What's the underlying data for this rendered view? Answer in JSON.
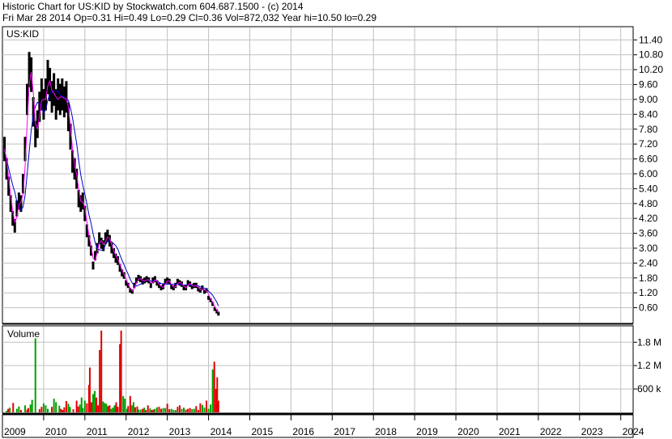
{
  "header": {
    "line1": "Historic Chart for US:KID by Stockwatch.com 604.687.1500 - (c) 2014",
    "line2": "Fri Mar 28 2014   Op=0.31   Hi=0.49   Lo=0.29   Cl=0.36   Vol=872,032   Year hi=10.50   lo=0.29"
  },
  "colors": {
    "grid": "#c0c0c0",
    "price": "#000000",
    "ma_short": "#ff00ff",
    "ma_long": "#0000cc",
    "vol_up": "#00a000",
    "vol_down": "#e00000"
  },
  "chart_data": [
    {
      "type": "line",
      "title": "US:KID",
      "y_ticks": [
        "11.40",
        "10.80",
        "10.20",
        "9.60",
        "9.00",
        "8.40",
        "7.80",
        "7.20",
        "6.60",
        "6.00",
        "5.40",
        "4.80",
        "4.20",
        "3.60",
        "3.00",
        "2.40",
        "1.80",
        "1.20",
        "0.60"
      ],
      "ylim": [
        0,
        11.9
      ],
      "x_labels": [
        "2009",
        "2010",
        "2011",
        "2012",
        "2013",
        "2014",
        "2015",
        "2016",
        "2017",
        "2018",
        "2019",
        "2020",
        "2021",
        "2022",
        "2023",
        "2024"
      ],
      "x_range": [
        2009.0,
        2024.3
      ],
      "series": [
        {
          "x": [
            2009.05,
            2009.1,
            2009.15,
            2009.2,
            2009.25,
            2009.3,
            2009.35,
            2009.4,
            2009.45,
            2009.5,
            2009.55,
            2009.6,
            2009.65,
            2009.7,
            2009.75,
            2009.8,
            2009.85,
            2009.9,
            2009.95,
            2010.0,
            2010.05,
            2010.1,
            2010.15,
            2010.2,
            2010.25,
            2010.3,
            2010.35,
            2010.4,
            2010.45,
            2010.5,
            2010.55,
            2010.6,
            2010.65,
            2010.7,
            2010.75,
            2010.8,
            2010.85,
            2010.9,
            2010.95,
            2011.0,
            2011.05,
            2011.1,
            2011.15,
            2011.2,
            2011.25,
            2011.3,
            2011.35,
            2011.4,
            2011.45,
            2011.5,
            2011.55,
            2011.6,
            2011.65,
            2011.7,
            2011.75,
            2011.8,
            2011.85,
            2011.9,
            2011.95,
            2012.0,
            2012.05,
            2012.1,
            2012.15,
            2012.2,
            2012.25,
            2012.3,
            2012.35,
            2012.4,
            2012.45,
            2012.5,
            2012.55,
            2012.6,
            2012.65,
            2012.7,
            2012.75,
            2012.8,
            2012.85,
            2012.9,
            2012.95,
            2013.0,
            2013.05,
            2013.1,
            2013.15,
            2013.2,
            2013.25,
            2013.3,
            2013.35,
            2013.4,
            2013.45,
            2013.5,
            2013.55,
            2013.6,
            2013.65,
            2013.7,
            2013.75,
            2013.8,
            2013.85,
            2013.9,
            2013.95,
            2014.0,
            2014.05,
            2014.1,
            2014.15,
            2014.2,
            2014.24
          ],
          "values": [
            7.0,
            6.2,
            5.5,
            4.8,
            4.2,
            3.9,
            4.6,
            4.9,
            4.8,
            5.6,
            7.0,
            9.0,
            10.2,
            10.0,
            8.5,
            7.6,
            8.0,
            8.7,
            9.2,
            8.8,
            9.2,
            9.9,
            9.6,
            9.1,
            9.4,
            8.8,
            9.2,
            9.0,
            9.2,
            8.9,
            9.1,
            8.3,
            7.5,
            6.5,
            6.2,
            5.8,
            5.0,
            4.8,
            4.9,
            4.4,
            3.7,
            3.3,
            2.9,
            2.3,
            2.7,
            3.0,
            3.4,
            3.2,
            3.1,
            3.4,
            3.5,
            3.3,
            3.0,
            2.8,
            2.6,
            2.5,
            2.2,
            2.0,
            1.9,
            1.6,
            1.5,
            1.3,
            1.25,
            1.5,
            1.7,
            1.8,
            1.75,
            1.65,
            1.7,
            1.75,
            1.7,
            1.5,
            1.7,
            1.75,
            1.6,
            1.5,
            1.4,
            1.45,
            1.65,
            1.7,
            1.65,
            1.45,
            1.4,
            1.5,
            1.65,
            1.6,
            1.55,
            1.4,
            1.4,
            1.6,
            1.55,
            1.45,
            1.5,
            1.5,
            1.35,
            1.3,
            1.4,
            1.25,
            1.3,
            1.0,
            0.9,
            0.75,
            0.55,
            0.45,
            0.36
          ]
        }
      ]
    },
    {
      "type": "bar",
      "title": "Volume",
      "y_ticks": [
        "1.8 M",
        "1.2 M",
        "600 k"
      ],
      "ylim": [
        0,
        2200000
      ],
      "series": [
        {
          "x": [
            2009.1,
            2009.18,
            2009.26,
            2009.35,
            2009.45,
            2009.55,
            2009.63,
            2009.72,
            2009.8,
            2009.9,
            2010.0,
            2010.1,
            2010.2,
            2010.3,
            2010.38,
            2010.46,
            2010.55,
            2010.64,
            2010.72,
            2010.8,
            2010.88,
            2010.95,
            2011.05,
            2011.12,
            2011.2,
            2011.28,
            2011.36,
            2011.44,
            2011.52,
            2011.6,
            2011.68,
            2011.76,
            2011.85,
            2011.93,
            2012.02,
            2012.1,
            2012.18,
            2012.27,
            2012.35,
            2012.44,
            2012.53,
            2012.62,
            2012.7,
            2012.8,
            2012.9,
            2013.0,
            2013.1,
            2013.2,
            2013.3,
            2013.4,
            2013.5,
            2013.6,
            2013.7,
            2013.8,
            2013.9,
            2014.0,
            2014.1,
            2014.18,
            2014.24
          ],
          "values": [
            40000,
            120000,
            240000,
            90000,
            60000,
            180000,
            110000,
            320000,
            1900000,
            80000,
            230000,
            90000,
            140000,
            260000,
            170000,
            60000,
            290000,
            140000,
            80000,
            300000,
            200000,
            110000,
            230000,
            1150000,
            470000,
            380000,
            1600000,
            280000,
            220000,
            180000,
            120000,
            260000,
            1750000,
            420000,
            90000,
            420000,
            260000,
            150000,
            70000,
            120000,
            180000,
            60000,
            90000,
            140000,
            110000,
            220000,
            90000,
            60000,
            180000,
            120000,
            90000,
            80000,
            160000,
            230000,
            120000,
            90000,
            1100000,
            600000,
            300000
          ],
          "dir": [
            1,
            1,
            0,
            1,
            0,
            1,
            0,
            1,
            1,
            0,
            1,
            1,
            0,
            1,
            1,
            0,
            0,
            1,
            0,
            0,
            1,
            1,
            0,
            0,
            1,
            0,
            0,
            1,
            1,
            0,
            1,
            0,
            0,
            1,
            1,
            0,
            1,
            0,
            1,
            1,
            0,
            0,
            1,
            0,
            1,
            0,
            1,
            1,
            0,
            1,
            0,
            1,
            0,
            0,
            1,
            1,
            1,
            0,
            0
          ]
        },
        {
          "x": [
            2009.14,
            2009.4,
            2009.6,
            2009.68,
            2009.95,
            2010.05,
            2010.25,
            2010.42,
            2010.5,
            2010.6,
            2010.84,
            2010.92,
            2011.0,
            2011.1,
            2011.16,
            2011.24,
            2011.32,
            2011.4,
            2011.48,
            2011.56,
            2011.64,
            2011.72,
            2011.8,
            2011.88,
            2011.97,
            2012.05,
            2012.14,
            2012.22,
            2012.3,
            2012.4,
            2012.48,
            2012.58,
            2012.66,
            2012.75,
            2012.85,
            2012.95,
            2013.05,
            2013.15,
            2013.25,
            2013.35,
            2013.45,
            2013.55,
            2013.65,
            2013.75,
            2013.85,
            2013.95,
            2014.05,
            2014.14,
            2014.21
          ],
          "values": [
            90000,
            150000,
            70000,
            200000,
            140000,
            180000,
            350000,
            90000,
            130000,
            220000,
            150000,
            380000,
            300000,
            700000,
            260000,
            550000,
            180000,
            2100000,
            240000,
            160000,
            90000,
            180000,
            140000,
            2100000,
            350000,
            160000,
            180000,
            130000,
            70000,
            90000,
            60000,
            100000,
            70000,
            130000,
            90000,
            110000,
            80000,
            60000,
            140000,
            90000,
            70000,
            110000,
            90000,
            60000,
            190000,
            300000,
            200000,
            1300000,
            900000
          ],
          "dir": [
            0,
            1,
            0,
            1,
            0,
            1,
            1,
            0,
            0,
            1,
            0,
            1,
            1,
            0,
            0,
            1,
            0,
            0,
            1,
            0,
            1,
            1,
            0,
            0,
            1,
            0,
            1,
            0,
            1,
            0,
            0,
            1,
            0,
            1,
            0,
            1,
            0,
            1,
            0,
            1,
            0,
            0,
            1,
            0,
            1,
            0,
            1,
            0,
            0
          ]
        }
      ]
    }
  ]
}
